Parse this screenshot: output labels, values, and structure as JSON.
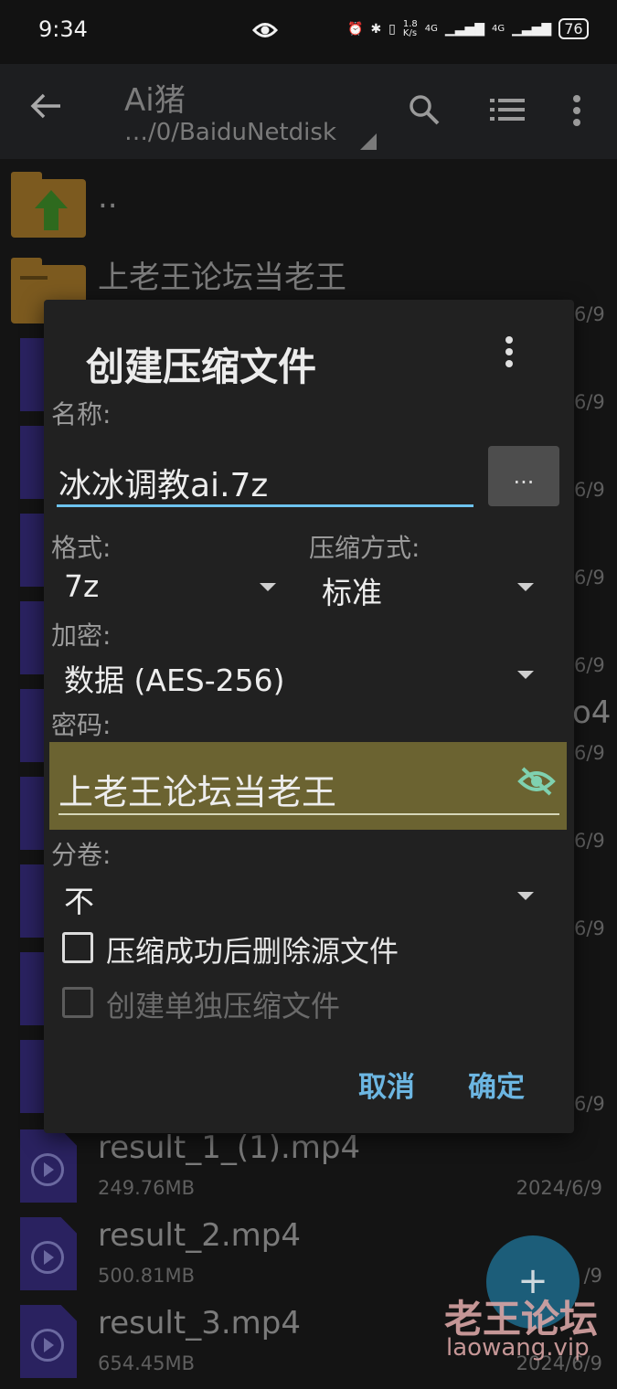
{
  "status_bar": {
    "time": "9:34",
    "speed_top": "1.8",
    "speed_bottom": "K/s",
    "net1": "4G",
    "net2": "4G",
    "battery": "76"
  },
  "appbar": {
    "title": "Ai猪",
    "path": "…/0/BaiduNetdisk",
    "icons": [
      "back-arrow-icon",
      "search-icon",
      "list-view-icon",
      "more-vert-icon"
    ]
  },
  "files": {
    "parent": "..",
    "folder": "上老王论坛当老王",
    "side_dates": [
      "6/9",
      "6/9",
      "6/9",
      "6/9",
      "6/9",
      "6/9",
      "6/9",
      "6/9",
      "6/9"
    ],
    "side_partial": "o4",
    "items": [
      {
        "name": "result_1_(1).mp4",
        "size": "249.76MB",
        "date": "2024/6/9"
      },
      {
        "name": "result_2.mp4",
        "size": "500.81MB",
        "date": "/9"
      },
      {
        "name": "result_3.mp4",
        "size": "654.45MB",
        "date": "2024/6/9"
      }
    ]
  },
  "dialog": {
    "title": "创建压缩文件",
    "name_label": "名称:",
    "name_value": "冰冰调教ai.7z",
    "ellipsis": "...",
    "format_label": "格式:",
    "format_value": "7z",
    "method_label": "压缩方式:",
    "method_value": "标准",
    "encrypt_label": "加密:",
    "encrypt_value": "数据 (AES-256)",
    "password_label": "密码:",
    "password_value": "上老王论坛当老王",
    "volume_label": "分卷:",
    "volume_value": "不",
    "checkbox_delete": "压缩成功后删除源文件",
    "checkbox_separate": "创建单独压缩文件",
    "cancel": "取消",
    "confirm": "确定"
  },
  "fab": {
    "label": "+"
  },
  "watermark": {
    "cn": "老王论坛",
    "en": "laowang.vip"
  },
  "colors": {
    "accent": "#6dc3ef",
    "button_text": "#6cb6e2",
    "password_bg": "#6b6331",
    "folder": "#7c5a1f",
    "video_icon": "#2a2260"
  }
}
